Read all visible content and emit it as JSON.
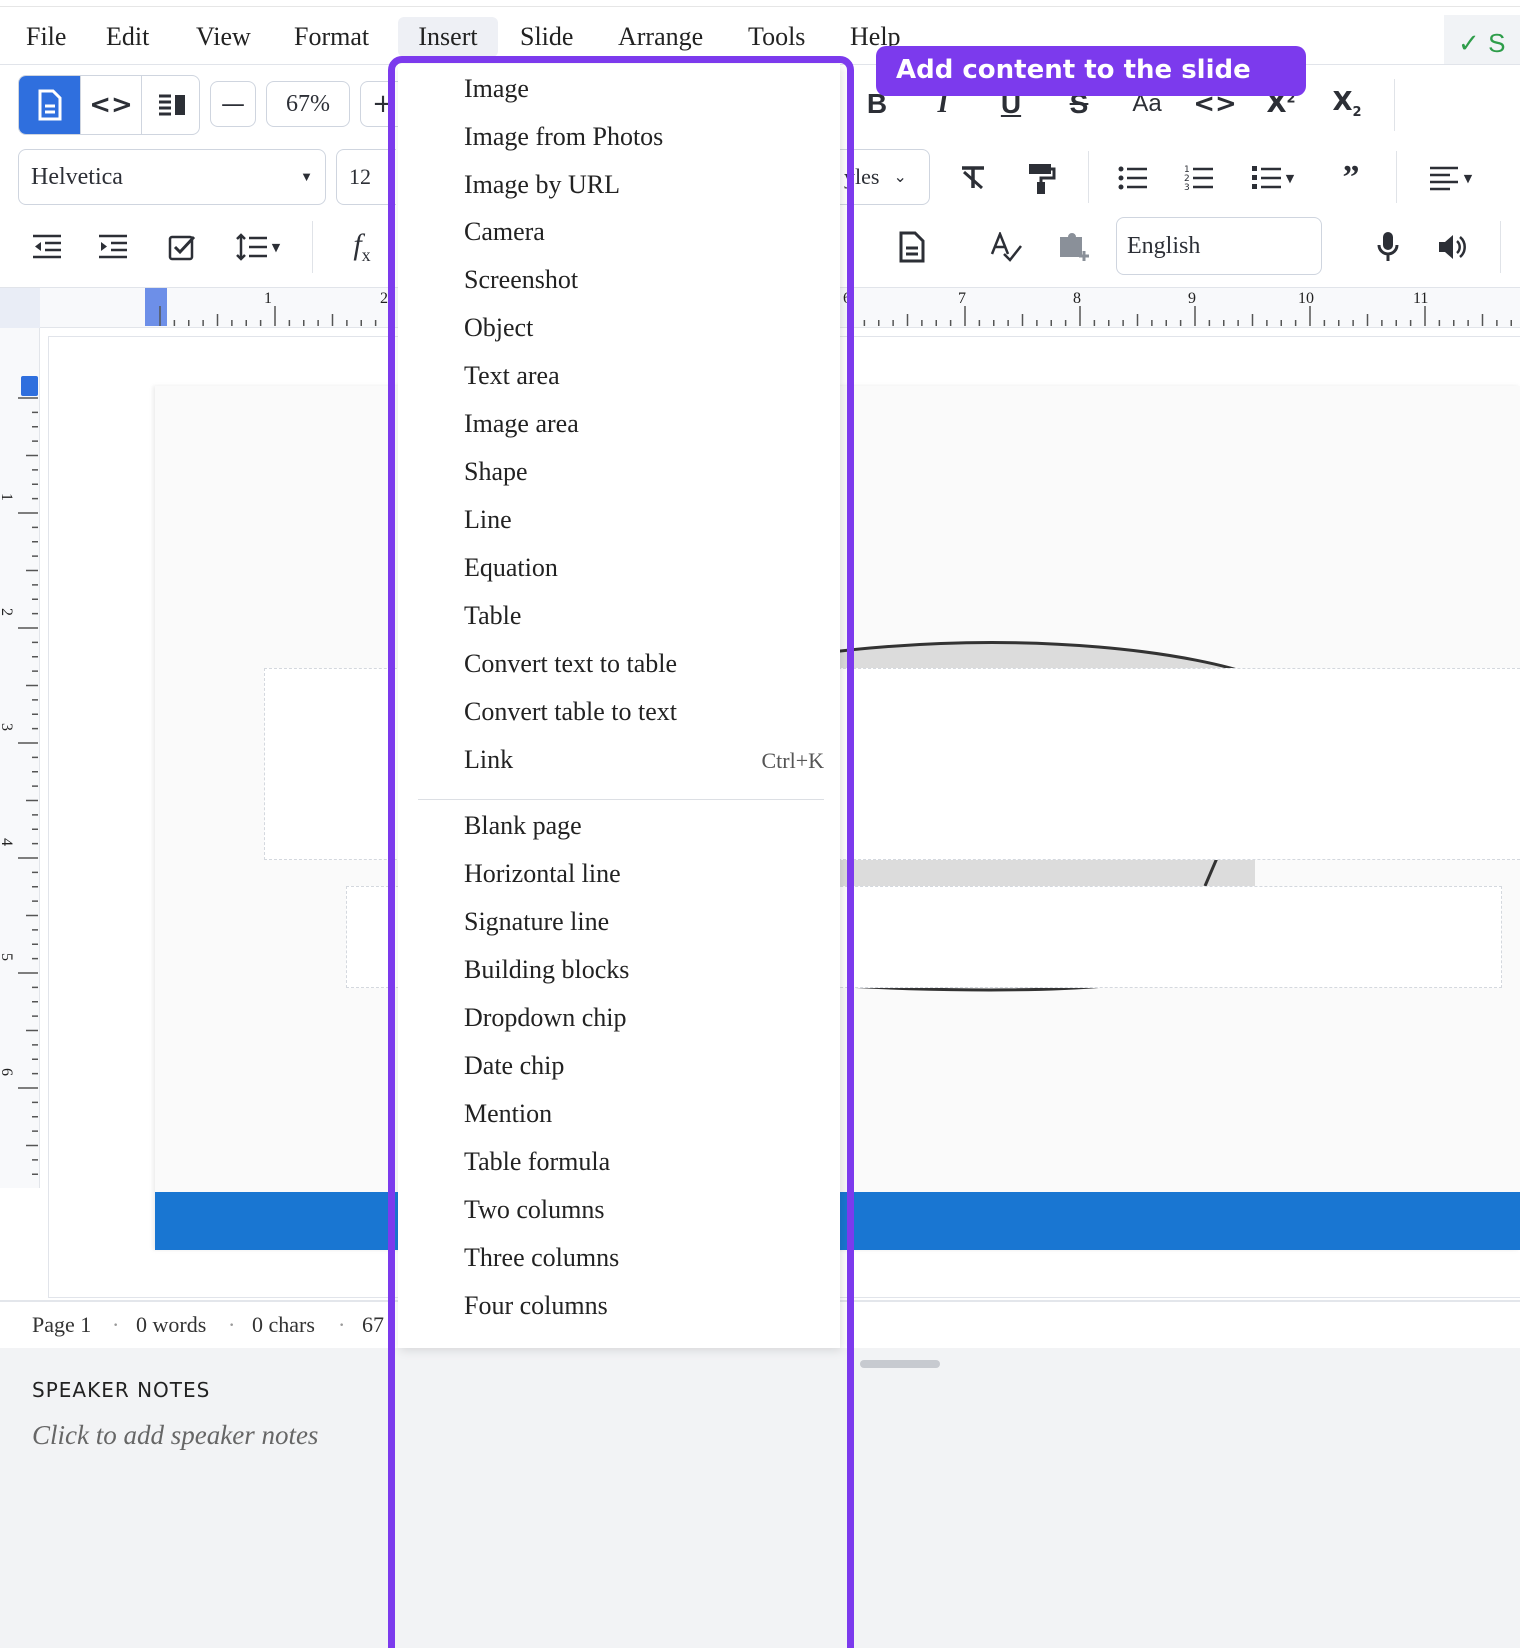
{
  "menubar": {
    "items": [
      "File",
      "Edit",
      "View",
      "Format",
      "Insert",
      "Slide",
      "Arrange",
      "Tools",
      "Help"
    ],
    "active": "Insert",
    "save_status_icon": "check-icon",
    "save_status_text": "S"
  },
  "toolbar": {
    "zoom": "67%",
    "font_family": "Helvetica",
    "font_size": "12",
    "styles_fragment": "yles",
    "case_label": "Aa",
    "language": "English",
    "zoom_out_label": "—",
    "zoom_in_label": "+"
  },
  "ruler": {
    "h_labels": [
      "1",
      "2",
      "6",
      "7",
      "8",
      "9",
      "10",
      "11"
    ],
    "v_labels": [
      "1",
      "2",
      "3",
      "4",
      "5",
      "6"
    ]
  },
  "statusbar": {
    "page": "Page 1",
    "words": "0 words",
    "chars": "0 chars",
    "zoom": "67"
  },
  "notes": {
    "title": "SPEAKER NOTES",
    "placeholder": "Click to add speaker notes"
  },
  "insert_menu": {
    "group1": [
      "Image",
      "Image from Photos",
      "Image by URL",
      "Camera",
      "Screenshot",
      "Object",
      "Text area",
      "Image area",
      "Shape",
      "Line",
      "Equation",
      "Table",
      "Convert text to table",
      "Convert table to text",
      "Link"
    ],
    "link_shortcut": "Ctrl+K",
    "group2": [
      "Blank page",
      "Horizontal line",
      "Signature line",
      "Building blocks",
      "Dropdown chip",
      "Date chip",
      "Mention",
      "Table formula",
      "Two columns",
      "Three columns",
      "Four columns"
    ]
  },
  "tooltip": "Add content to the slide",
  "colors": {
    "accent": "#7c3aed",
    "primary": "#2f6fde",
    "slide_bar": "#1976d2",
    "success": "#2e9d4a"
  }
}
